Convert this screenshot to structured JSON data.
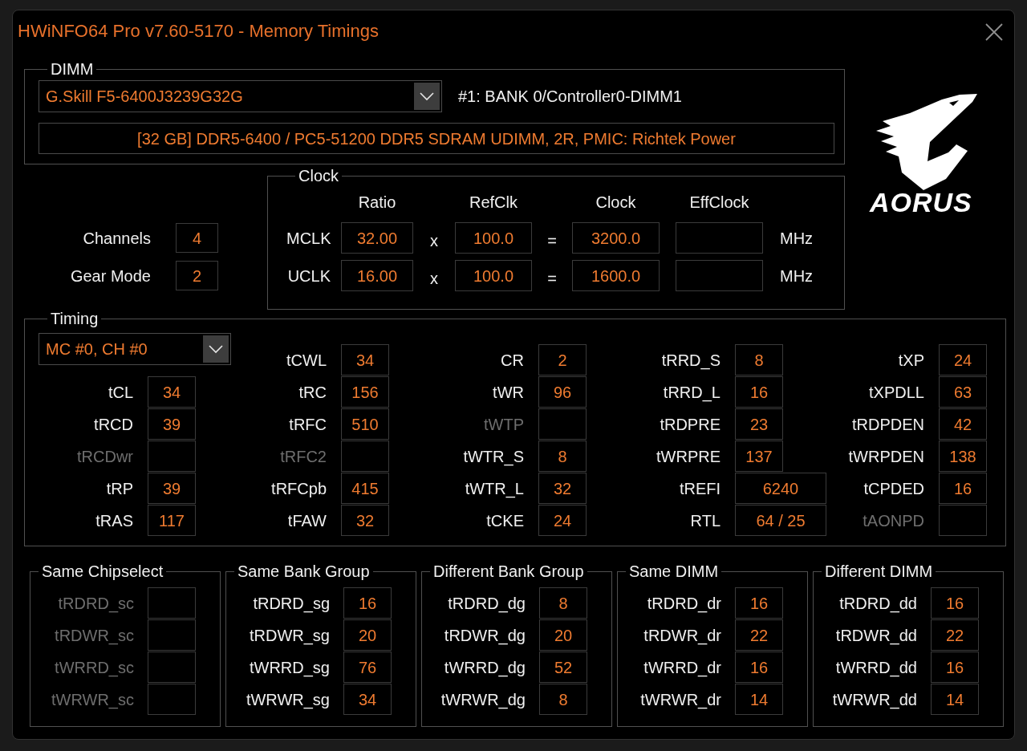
{
  "window": {
    "title": "HWiNFO64 Pro v7.60-5170 - Memory Timings"
  },
  "dimm": {
    "legend": "DIMM",
    "module": "G.Skill F5-6400J3239G32G",
    "slot": "#1: BANK 0/Controller0-DIMM1",
    "description": "[32 GB] DDR5-6400 / PC5-51200 DDR5 SDRAM UDIMM, 2R, PMIC: Richtek Power"
  },
  "logo": {
    "text": "AORUS"
  },
  "summary": [
    {
      "label": "Channels",
      "value": "4"
    },
    {
      "label": "Gear Mode",
      "value": "2"
    }
  ],
  "clock": {
    "legend": "Clock",
    "headers": [
      "Ratio",
      "RefClk",
      "Clock",
      "EffClock"
    ],
    "rows": [
      {
        "label": "MCLK",
        "ratio": "32.00",
        "multiply": "x",
        "refclk": "100.0",
        "equals": "=",
        "clock": "3200.0",
        "unit": "MHz"
      },
      {
        "label": "UCLK",
        "ratio": "16.00",
        "multiply": "x",
        "refclk": "100.0",
        "equals": "=",
        "clock": "1600.0",
        "unit": "MHz"
      }
    ]
  },
  "timing": {
    "legend": "Timing",
    "channel": "MC #0, CH #0",
    "columns": [
      {
        "items": [
          {
            "label": "tCL",
            "value": "34",
            "disabled": false
          },
          {
            "label": "tRCD",
            "value": "39",
            "disabled": false
          },
          {
            "label": "tRCDwr",
            "disabled": true
          },
          {
            "label": "tRP",
            "value": "39",
            "disabled": false
          },
          {
            "label": "tRAS",
            "value": "117",
            "disabled": false
          }
        ]
      },
      {
        "items": [
          {
            "label": "tCWL",
            "value": "34",
            "disabled": false
          },
          {
            "label": "tRC",
            "value": "156",
            "disabled": false
          },
          {
            "label": "tRFC",
            "value": "510",
            "disabled": false
          },
          {
            "label": "tRFC2",
            "disabled": true
          },
          {
            "label": "tRFCpb",
            "value": "415",
            "disabled": false
          },
          {
            "label": "tFAW",
            "value": "32",
            "disabled": false
          }
        ]
      },
      {
        "items": [
          {
            "label": "CR",
            "value": "2",
            "disabled": false
          },
          {
            "label": "tWR",
            "value": "96",
            "disabled": false
          },
          {
            "label": "tWTP",
            "disabled": true
          },
          {
            "label": "tWTR_S",
            "value": "8",
            "disabled": false
          },
          {
            "label": "tWTR_L",
            "value": "32",
            "disabled": false
          },
          {
            "label": "tCKE",
            "value": "24",
            "disabled": false
          }
        ]
      },
      {
        "items": [
          {
            "label": "tRRD_S",
            "value": "8",
            "disabled": false,
            "kind": "narrow"
          },
          {
            "label": "tRRD_L",
            "value": "16",
            "disabled": false,
            "kind": "narrow"
          },
          {
            "label": "tRDPRE",
            "value": "23",
            "disabled": false,
            "kind": "narrow"
          },
          {
            "label": "tWRPRE",
            "value": "137",
            "disabled": false,
            "kind": "narrow"
          },
          {
            "label": "tREFI",
            "value": "6240",
            "disabled": false,
            "kind": "wide"
          },
          {
            "label": "RTL",
            "value": "64 / 25",
            "disabled": false,
            "kind": "wide"
          }
        ]
      },
      {
        "items": [
          {
            "label": "tXP",
            "value": "24",
            "disabled": false
          },
          {
            "label": "tXPDLL",
            "value": "63",
            "disabled": false
          },
          {
            "label": "tRDPDEN",
            "value": "42",
            "disabled": false
          },
          {
            "label": "tWRPDEN",
            "value": "138",
            "disabled": false
          },
          {
            "label": "tCPDED",
            "value": "16",
            "disabled": false
          },
          {
            "label": "tAONPD",
            "disabled": true
          }
        ]
      }
    ]
  },
  "groups": [
    {
      "title": "Same Chipselect",
      "rows": [
        {
          "label": "tRDRD_sc",
          "disabled": true
        },
        {
          "label": "tRDWR_sc",
          "disabled": true
        },
        {
          "label": "tWRRD_sc",
          "disabled": true
        },
        {
          "label": "tWRWR_sc",
          "disabled": true
        }
      ]
    },
    {
      "title": "Same Bank Group",
      "rows": [
        {
          "label": "tRDRD_sg",
          "value": "16",
          "disabled": false
        },
        {
          "label": "tRDWR_sg",
          "value": "20",
          "disabled": false
        },
        {
          "label": "tWRRD_sg",
          "value": "76",
          "disabled": false
        },
        {
          "label": "tWRWR_sg",
          "value": "34",
          "disabled": false
        }
      ]
    },
    {
      "title": "Different Bank Group",
      "rows": [
        {
          "label": "tRDRD_dg",
          "value": "8",
          "disabled": false
        },
        {
          "label": "tRDWR_dg",
          "value": "20",
          "disabled": false
        },
        {
          "label": "tWRRD_dg",
          "value": "52",
          "disabled": false
        },
        {
          "label": "tWRWR_dg",
          "value": "8",
          "disabled": false
        }
      ]
    },
    {
      "title": "Same DIMM",
      "rows": [
        {
          "label": "tRDRD_dr",
          "value": "16",
          "disabled": false
        },
        {
          "label": "tRDWR_dr",
          "value": "22",
          "disabled": false
        },
        {
          "label": "tWRRD_dr",
          "value": "16",
          "disabled": false
        },
        {
          "label": "tWRWR_dr",
          "value": "14",
          "disabled": false
        }
      ]
    },
    {
      "title": "Different DIMM",
      "rows": [
        {
          "label": "tRDRD_dd",
          "value": "16",
          "disabled": false
        },
        {
          "label": "tRDWR_dd",
          "value": "22",
          "disabled": false
        },
        {
          "label": "tWRRD_dd",
          "value": "16",
          "disabled": false
        },
        {
          "label": "tWRWR_dd",
          "value": "14",
          "disabled": false
        }
      ]
    }
  ]
}
